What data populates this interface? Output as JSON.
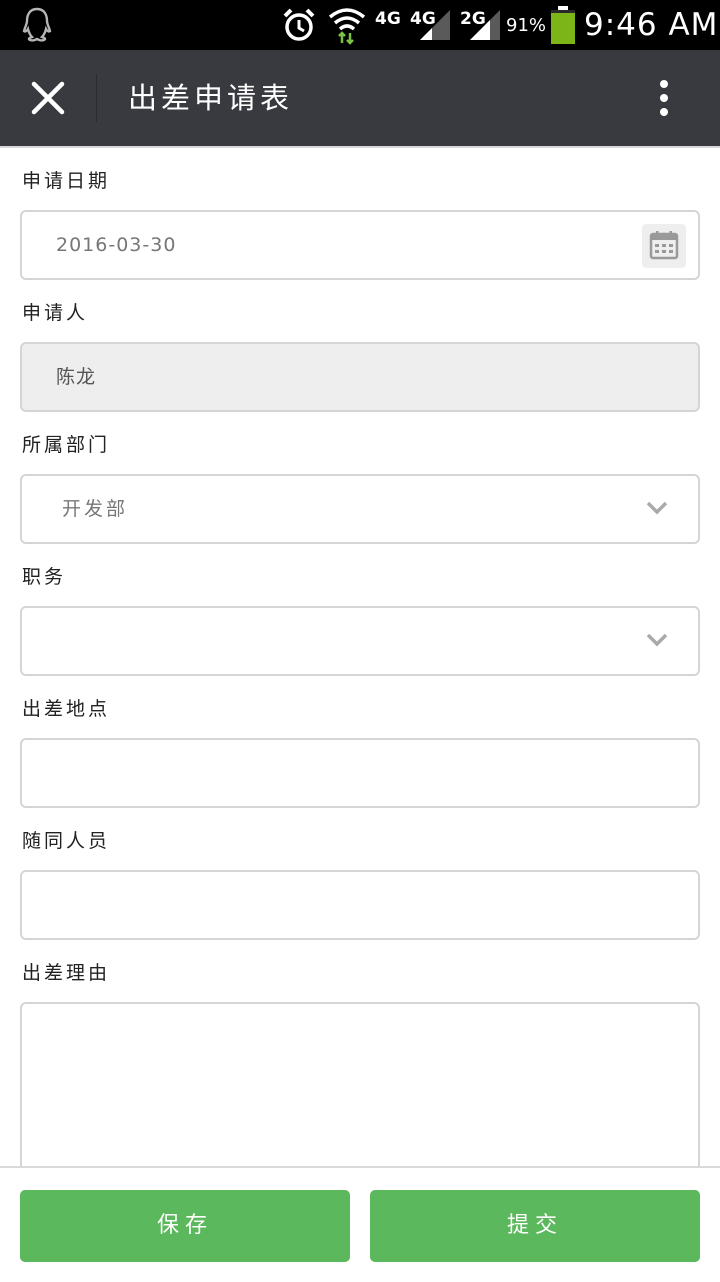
{
  "status_bar": {
    "time": "9:46 AM",
    "battery_percent": "91%",
    "network_1": "4G",
    "network_2": "4G",
    "network_3": "2G",
    "icons": [
      "qq-icon",
      "alarm-icon",
      "wifi-icon",
      "signal-icon",
      "battery-icon"
    ]
  },
  "appbar": {
    "title": "出差申请表",
    "close_icon": "close-icon",
    "more_icon": "more-vert-icon",
    "background": "#393a3f"
  },
  "form": {
    "apply_date": {
      "label": "申请日期",
      "value": "2016-03-30",
      "icon": "calendar-icon"
    },
    "applicant": {
      "label": "申请人",
      "value": "陈龙"
    },
    "department": {
      "label": "所属部门",
      "value": "开发部",
      "icon": "chevron-down-icon"
    },
    "position": {
      "label": "职务",
      "value": "",
      "icon": "chevron-down-icon"
    },
    "location": {
      "label": "出差地点",
      "value": ""
    },
    "companions": {
      "label": "随同人员",
      "value": ""
    },
    "reason": {
      "label": "出差理由",
      "value": ""
    }
  },
  "actions": {
    "save_label": "保存",
    "submit_label": "提交",
    "button_color": "#5cb85c"
  }
}
